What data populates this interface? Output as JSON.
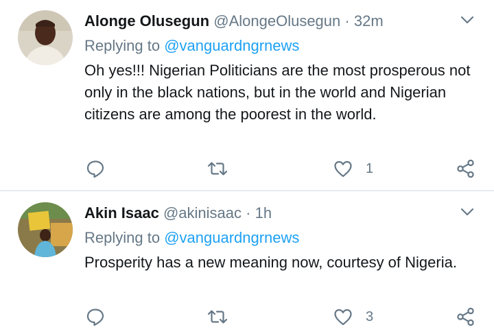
{
  "tweets": [
    {
      "name": "Alonge Olusegun",
      "handle": "@AlongeOlusegun",
      "separator": "·",
      "time": "32m",
      "replying_prefix": "Replying to ",
      "replying_to": "@vanguardngrnews",
      "text": "Oh yes!!! Nigerian Politicians are the most prosperous not only in the black nations, but in the world and Nigerian citizens are among the poorest in the world.",
      "likes": "1"
    },
    {
      "name": "Akin Isaac",
      "handle": "@akinisaac",
      "separator": "·",
      "time": "1h",
      "replying_prefix": "Replying to ",
      "replying_to": "@vanguardngrnews",
      "text": "Prosperity has a new meaning now, courtesy of Nigeria.",
      "likes": "3"
    }
  ],
  "icons": {
    "reply": "reply-icon",
    "retweet": "retweet-icon",
    "like": "heart-icon",
    "share": "share-icon",
    "caret": "chevron-down-icon"
  },
  "colors": {
    "link": "#1da1f2",
    "muted": "#657786",
    "text": "#14171a",
    "divider": "#e6ecf0"
  }
}
